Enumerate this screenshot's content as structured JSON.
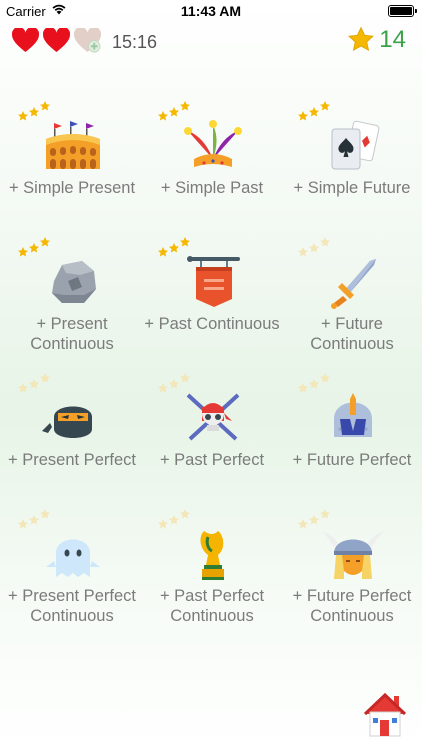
{
  "status_bar": {
    "carrier": "Carrier",
    "time": "11:43 AM"
  },
  "header": {
    "lives": [
      {
        "state": "full"
      },
      {
        "state": "full"
      },
      {
        "state": "empty-refill"
      }
    ],
    "timer": "15:16",
    "stars_total": "14"
  },
  "levels": [
    {
      "label": "+ Simple Present",
      "stars_earned": 3,
      "icon": "colosseum-icon"
    },
    {
      "label": "+ Simple Past",
      "stars_earned": 3,
      "icon": "jester-hat-icon"
    },
    {
      "label": "+ Simple Future",
      "stars_earned": 3,
      "icon": "playing-cards-icon"
    },
    {
      "label": "+ Present Continuous",
      "stars_earned": 3,
      "icon": "rock-icon"
    },
    {
      "label": "+ Past Continuous",
      "stars_earned": 3,
      "icon": "tavern-sign-icon"
    },
    {
      "label": "+ Future Continuous",
      "stars_earned": 0,
      "icon": "sword-icon"
    },
    {
      "label": "+ Present Perfect",
      "stars_earned": 0,
      "icon": "ninja-icon"
    },
    {
      "label": "+ Past Perfect",
      "stars_earned": 0,
      "icon": "pirate-skull-icon"
    },
    {
      "label": "+ Future Perfect",
      "stars_earned": 0,
      "icon": "knight-helmet-icon"
    },
    {
      "label": "+ Present Perfect Continuous",
      "stars_earned": 0,
      "icon": "ghost-icon"
    },
    {
      "label": "+ Past Perfect Continuous",
      "stars_earned": 0,
      "icon": "trophy-icon"
    },
    {
      "label": "+ Future Perfect Continuous",
      "stars_earned": 0,
      "icon": "viking-icon"
    }
  ],
  "footer": {
    "icon": "home-icon"
  },
  "colors": {
    "star_gold": "#f5b800",
    "star_faded": "#f3e6b8",
    "heart_red": "#e8101d",
    "accent_green": "#3aa24a"
  }
}
